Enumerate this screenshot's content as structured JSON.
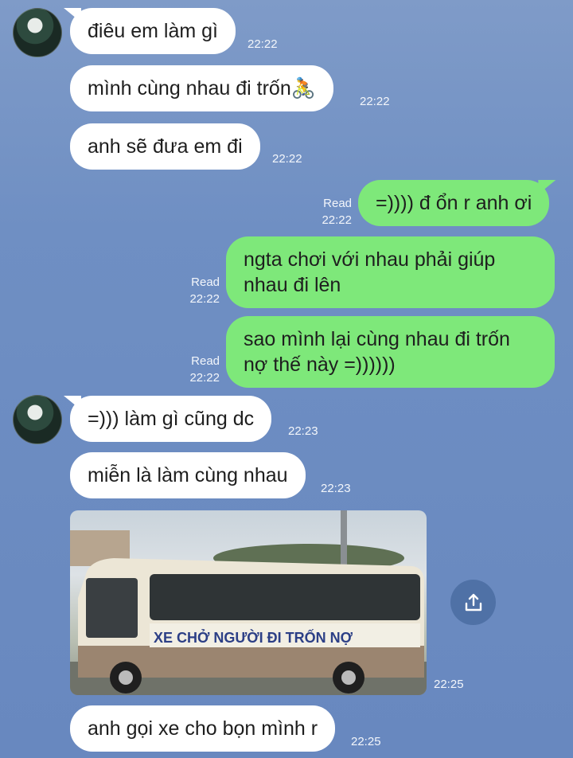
{
  "messages": [
    {
      "id": "m1",
      "side": "left",
      "text": "điêu em làm gì",
      "time": "22:22"
    },
    {
      "id": "m2",
      "side": "left",
      "text": "mình cùng nhau đi trốn",
      "emoji": "🚴",
      "time": "22:22"
    },
    {
      "id": "m3",
      "side": "left",
      "text": "anh sẽ đưa em đi",
      "time": "22:22"
    },
    {
      "id": "m4",
      "side": "right",
      "text": "=)))) đ ổn r anh ơi",
      "status": "Read",
      "time": "22:22"
    },
    {
      "id": "m5",
      "side": "right",
      "lines": [
        "ngta chơi với nhau phải giúp",
        "nhau đi lên"
      ],
      "status": "Read",
      "time": "22:22"
    },
    {
      "id": "m6",
      "side": "right",
      "lines": [
        "sao mình lại cùng nhau đi trốn",
        "nợ thế này =))))))"
      ],
      "status": "Read",
      "time": "22:22"
    },
    {
      "id": "m7",
      "side": "left",
      "text": "=))) làm gì cũng dc",
      "time": "22:23"
    },
    {
      "id": "m8",
      "side": "left",
      "text": "miễn là làm cùng nhau",
      "time": "22:23"
    },
    {
      "id": "m9",
      "side": "left",
      "type": "image",
      "image_caption": "XE CHỞ NGƯỜI ĐI TRỐN NỢ",
      "time": "22:25"
    },
    {
      "id": "m10",
      "side": "left",
      "text": "anh gọi xe cho bọn mình r",
      "time": "22:25"
    }
  ],
  "icons": {
    "share": "share-upload-icon",
    "avatar": "contact-avatar"
  },
  "colors": {
    "outgoing": "#7ee87a",
    "incoming": "#ffffff",
    "background": "#6f8fc3"
  }
}
